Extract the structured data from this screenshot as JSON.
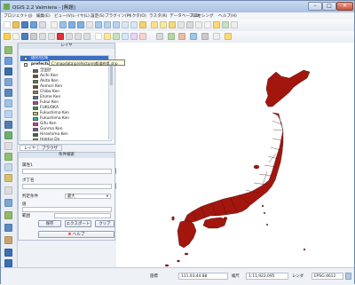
{
  "window": {
    "title": "QGIS 2.2 Valmiera - [無題]",
    "min_label": "–",
    "max_label": "□",
    "close_label": "✕"
  },
  "menu": [
    "プロジェクト(J)",
    "編集(E)",
    "ビュー(V)",
    "レイヤ(L)",
    "設定(S)",
    "プラグイン(P)",
    "ベクタ(O)",
    "ラスタ(R)",
    "データベース(D)",
    "プロセシング",
    "ヘルプ(H)"
  ],
  "layers_panel": {
    "title": "レイヤ",
    "group_label": "国名/区域",
    "layer_name": "prefecture_jpn",
    "tooltip": "C:\\mapdata\\prefecture\\都道府県.shp",
    "items": [
      {
        "label": "全国計",
        "color": "#7a5a3a"
      },
      {
        "label": "Aichi Ken",
        "color": "#6e4f33"
      },
      {
        "label": "Akita Ken",
        "color": "#5a7f3c"
      },
      {
        "label": "Aomori Ken",
        "color": "#6b4a2f"
      },
      {
        "label": "Chiba Ken",
        "color": "#9b7b53"
      },
      {
        "label": "Ehime Ken",
        "color": "#4a77b5"
      },
      {
        "label": "Fukui Ken",
        "color": "#9c4f9e"
      },
      {
        "label": "FUKUOKA",
        "color": "#3a9a55"
      },
      {
        "label": "Fukushima Ken",
        "color": "#b8d84a"
      },
      {
        "label": "Fukushima Ken",
        "color": "#3db3b8"
      },
      {
        "label": "Gifu Ken",
        "color": "#c44a8f"
      },
      {
        "label": "Gunma Ken",
        "color": "#8b4bb8"
      },
      {
        "label": "Hiroshima Ken",
        "color": "#2e6f3a"
      },
      {
        "label": "Hokkai Do",
        "color": "#d66a3d"
      },
      {
        "label": "Hyogo Ken",
        "color": "#8b8b3a"
      },
      {
        "label": "Ibaraki Ken",
        "color": "#b83a3a"
      }
    ],
    "tab_layers": "レイヤ",
    "tab_browser": "ブラウザ"
  },
  "plugin_panel": {
    "title": "条件検索",
    "field1_label": "属性1",
    "field2_label": "ボ丁名",
    "field3_label": "判定条件",
    "field3_value": "最大",
    "field4_label": "値",
    "field5_label": "範囲",
    "btn_save": "保存",
    "btn_export": "エクスポート",
    "btn_clear": "クリア",
    "btn_help": "ヘルプ"
  },
  "status": {
    "coordinate_label": "座標",
    "coordinate_value": "111.03,44.88",
    "scale_label": "縮尺",
    "scale_value": "1:11,922,095",
    "render_label": "レンダ",
    "crs_value": "EPSG:4612"
  },
  "map": {
    "fill_color": "#a3160e",
    "stroke_color": "#3a0a07"
  }
}
